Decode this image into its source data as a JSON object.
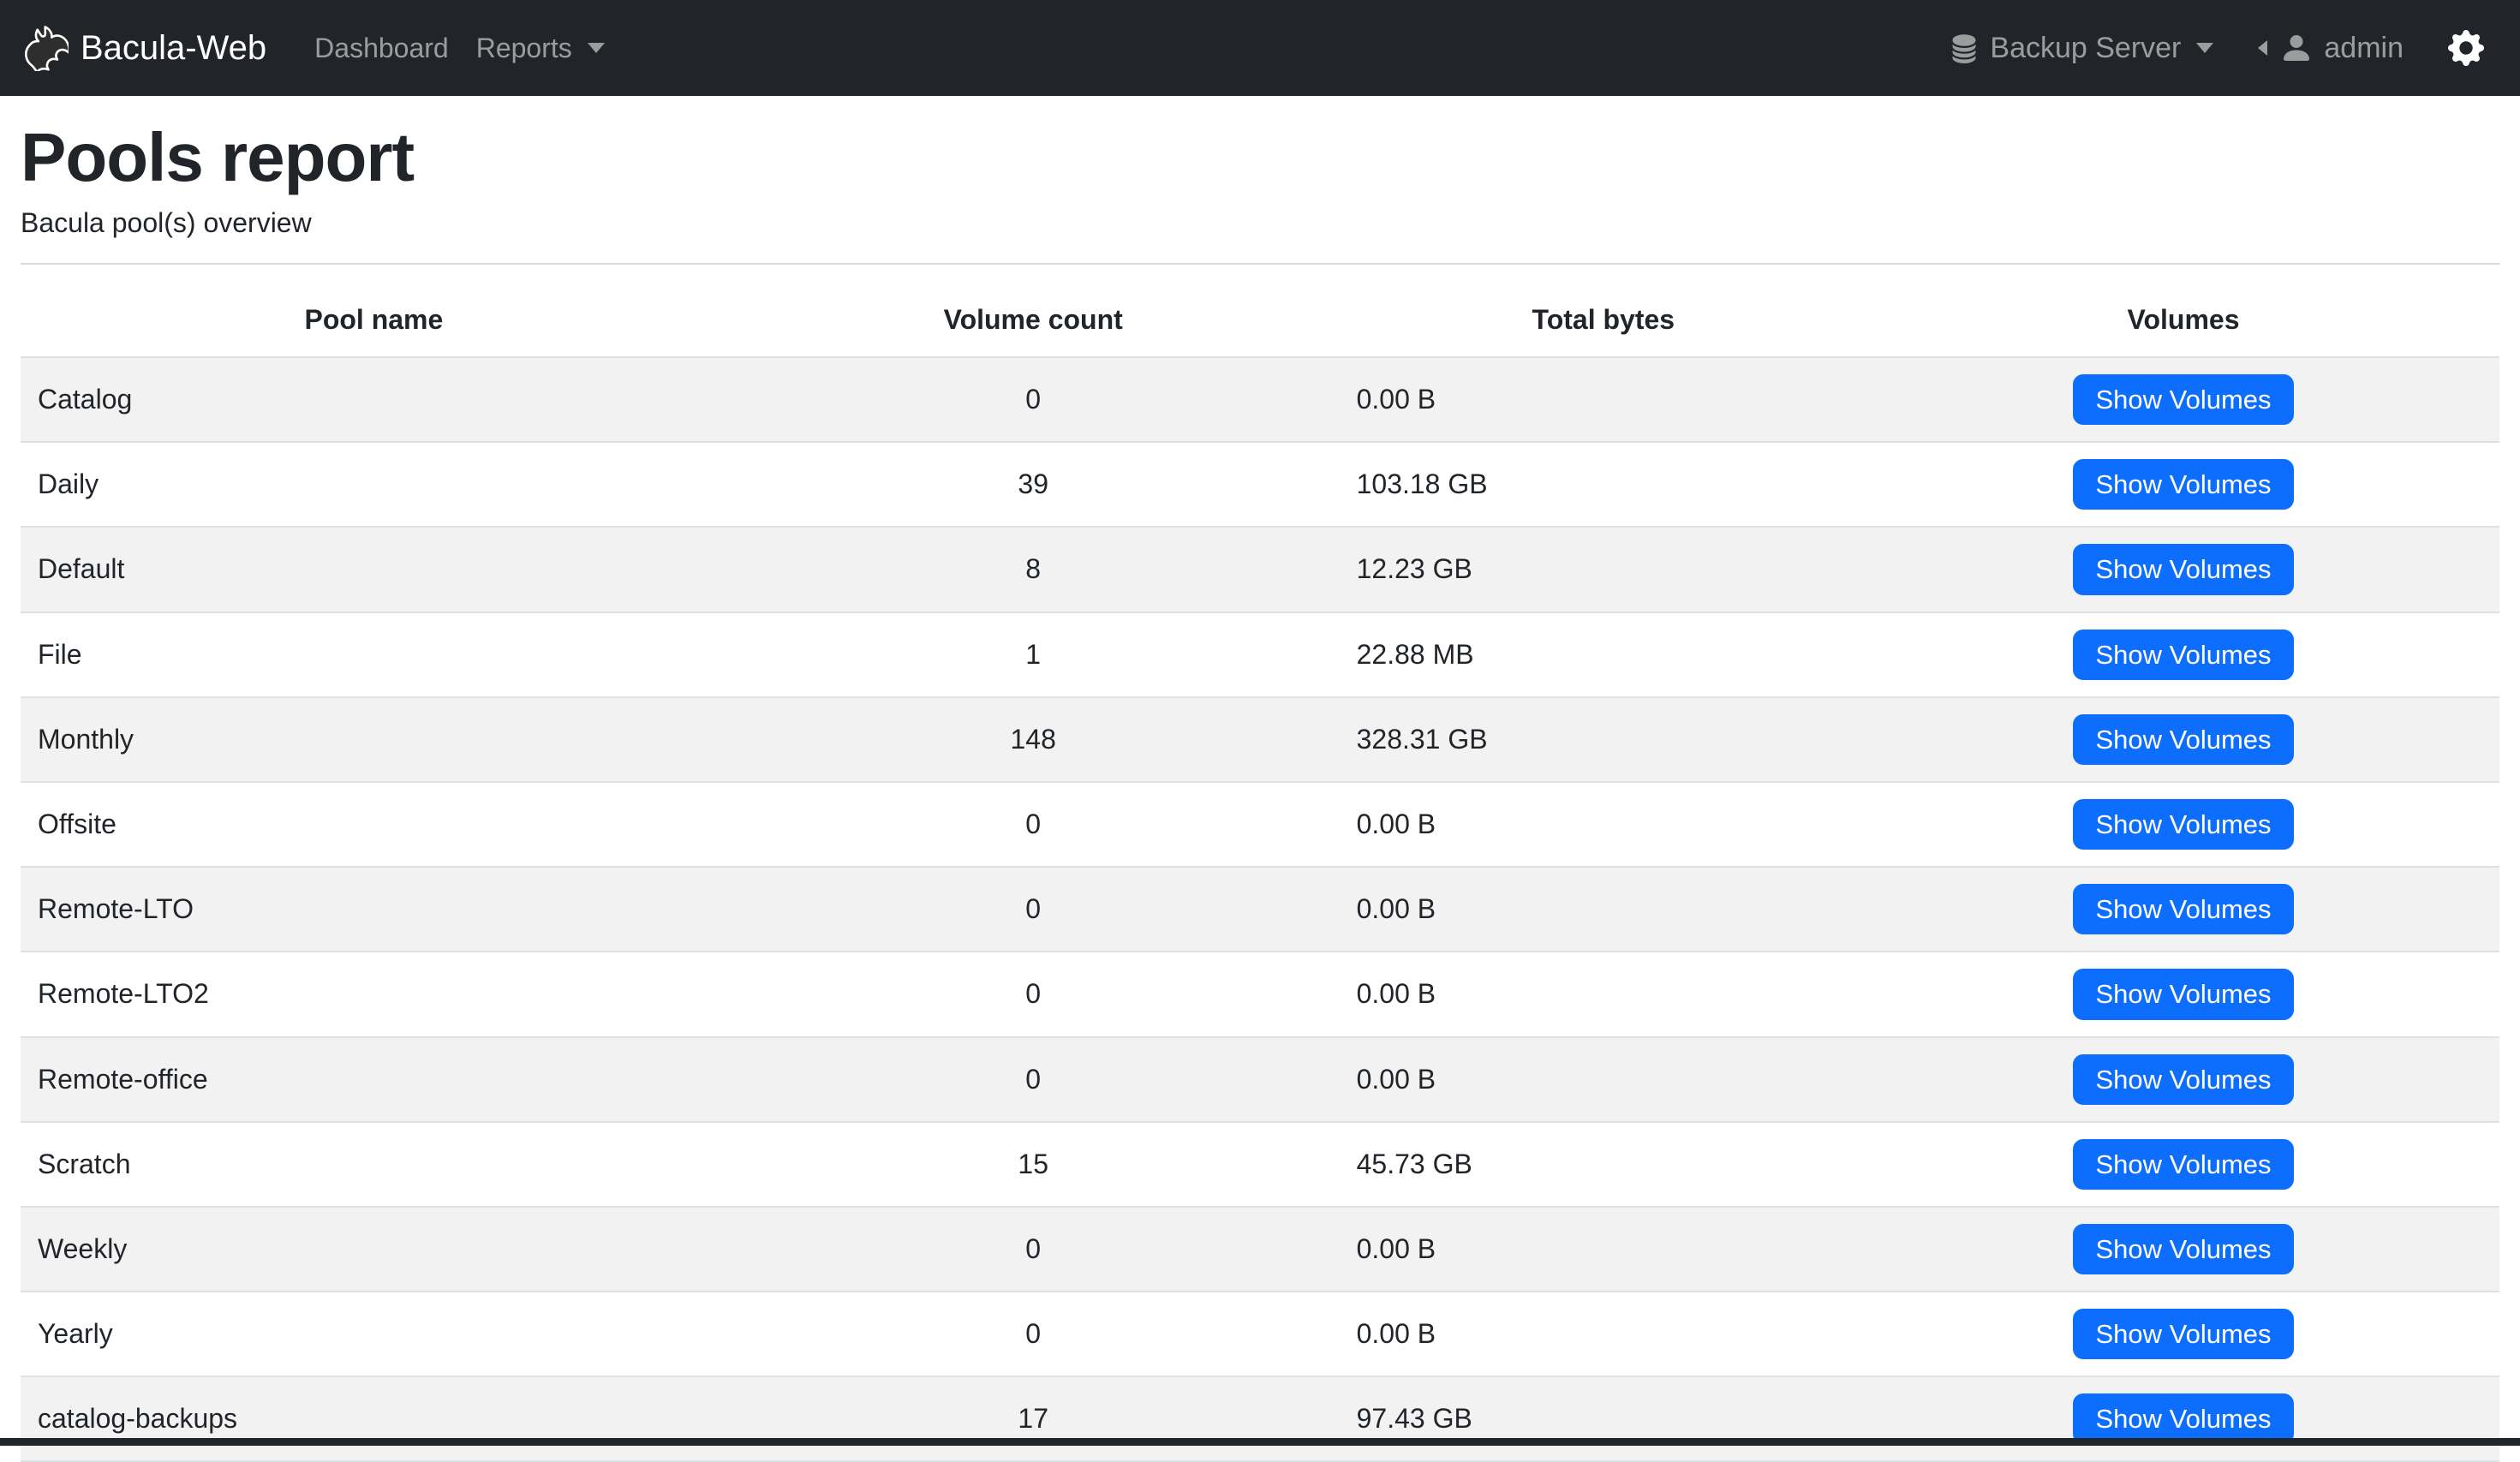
{
  "navbar": {
    "brand": "Bacula-Web",
    "links": [
      {
        "label": "Dashboard"
      },
      {
        "label": "Reports"
      }
    ],
    "server_menu": {
      "label": "Backup Server"
    },
    "user_menu": {
      "label": "admin"
    },
    "icons": {
      "logo": "bat-logo",
      "server": "database-icon",
      "user": "person-icon",
      "settings": "gear-icon",
      "dropdown": "caret-down-icon",
      "user_prefix": "caret-left-icon"
    }
  },
  "page": {
    "title": "Pools report",
    "subtitle": "Bacula pool(s) overview"
  },
  "table": {
    "headers": {
      "pool": "Pool name",
      "count": "Volume count",
      "bytes": "Total bytes",
      "volumes": "Volumes"
    },
    "action_label": "Show Volumes",
    "rows": [
      {
        "pool": "Catalog",
        "count": "0",
        "bytes": "0.00 B"
      },
      {
        "pool": "Daily",
        "count": "39",
        "bytes": "103.18 GB"
      },
      {
        "pool": "Default",
        "count": "8",
        "bytes": "12.23 GB"
      },
      {
        "pool": "File",
        "count": "1",
        "bytes": "22.88 MB"
      },
      {
        "pool": "Monthly",
        "count": "148",
        "bytes": "328.31 GB"
      },
      {
        "pool": "Offsite",
        "count": "0",
        "bytes": "0.00 B"
      },
      {
        "pool": "Remote-LTO",
        "count": "0",
        "bytes": "0.00 B"
      },
      {
        "pool": "Remote-LTO2",
        "count": "0",
        "bytes": "0.00 B"
      },
      {
        "pool": "Remote-office",
        "count": "0",
        "bytes": "0.00 B"
      },
      {
        "pool": "Scratch",
        "count": "15",
        "bytes": "45.73 GB"
      },
      {
        "pool": "Weekly",
        "count": "0",
        "bytes": "0.00 B"
      },
      {
        "pool": "Yearly",
        "count": "0",
        "bytes": "0.00 B"
      },
      {
        "pool": "catalog-backups",
        "count": "17",
        "bytes": "97.43 GB"
      }
    ]
  },
  "colors": {
    "navbar_bg": "#212529",
    "accent": "#0d6efd",
    "stripe": "#f2f2f2",
    "table_border": "#dee2e6",
    "footer_bg": "#212529"
  }
}
